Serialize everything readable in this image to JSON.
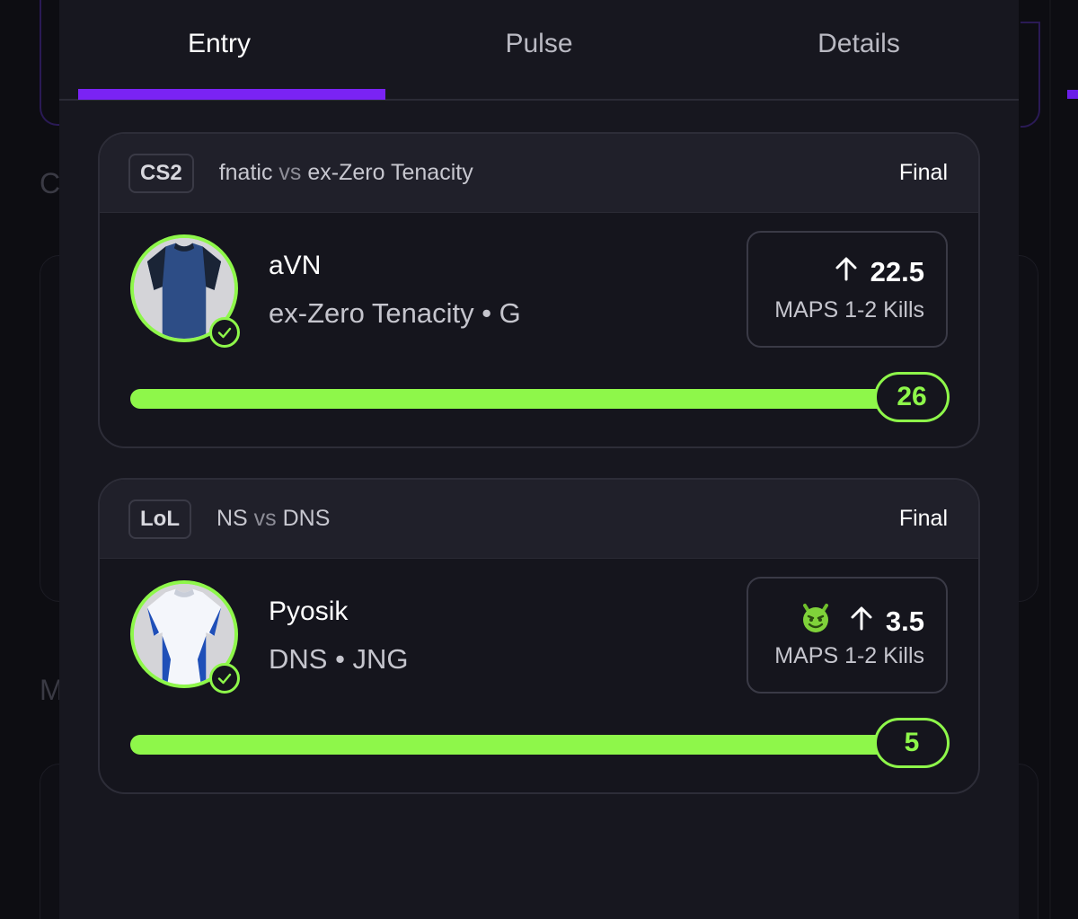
{
  "tabs": [
    {
      "label": "Entry",
      "active": true
    },
    {
      "label": "Pulse",
      "active": false
    },
    {
      "label": "Details",
      "active": false
    }
  ],
  "accent_color": "#7a23f4",
  "success_color": "#8ef74a",
  "entries": [
    {
      "game": "CS2",
      "team_a": "fnatic",
      "vs": "vs",
      "team_b": "ex-Zero Tenacity",
      "status": "Final",
      "player": "aVN",
      "team_position": "ex-Zero Tenacity • G",
      "jersey": "dark-blue-jersey-icon",
      "direction_icon": "arrow-up-icon",
      "line": "22.5",
      "stat_label": "MAPS 1-2 Kills",
      "result": "26",
      "progress": 1.0
    },
    {
      "game": "LoL",
      "team_a": "NS",
      "vs": "vs",
      "team_b": "DNS",
      "status": "Final",
      "player": "Pyosik",
      "team_position": "DNS • JNG",
      "jersey": "white-blue-jersey-icon",
      "badge_icon": "demon-emoji-icon",
      "direction_icon": "arrow-up-icon",
      "line": "3.5",
      "stat_label": "MAPS 1-2 Kills",
      "result": "5",
      "progress": 1.0
    }
  ]
}
